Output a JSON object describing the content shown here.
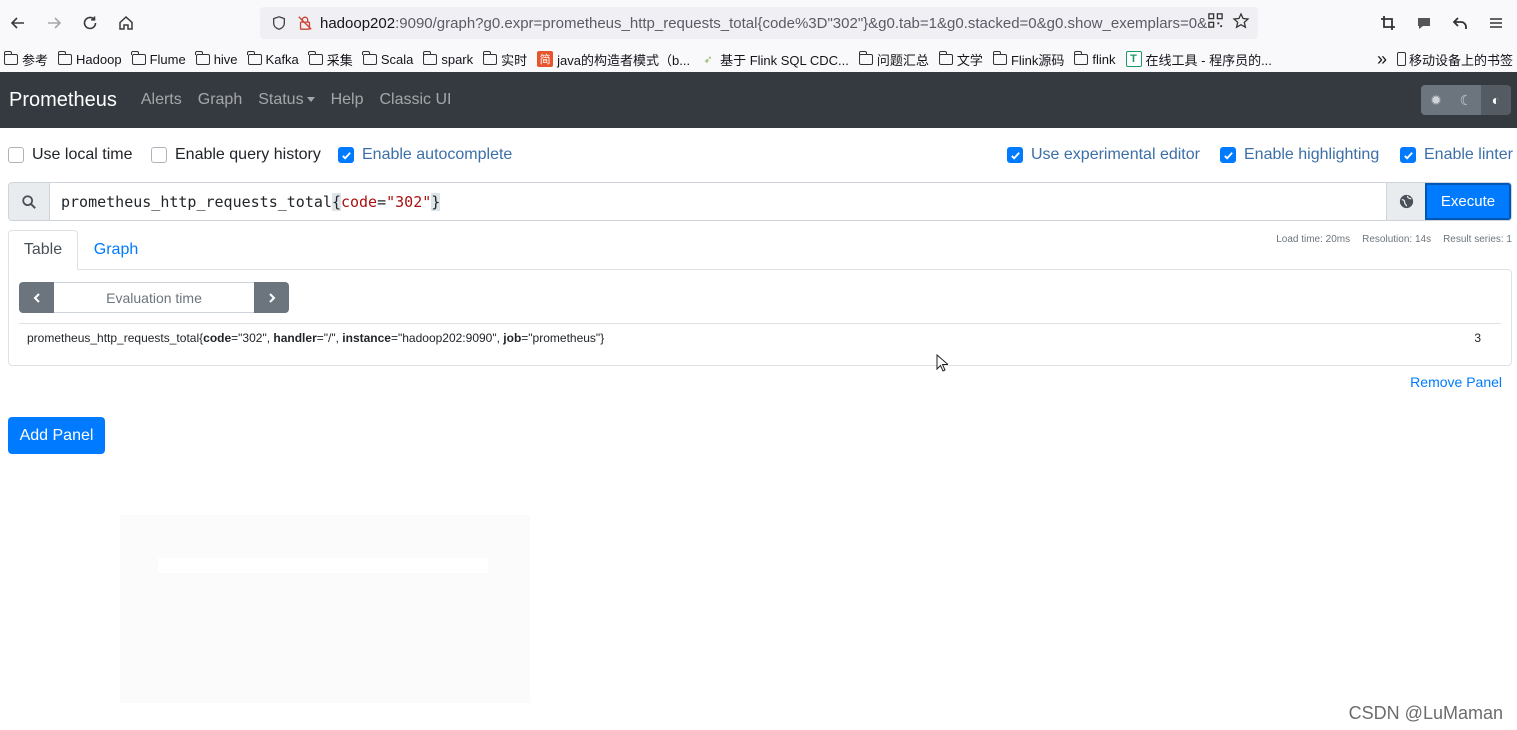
{
  "browser": {
    "url_host": "hadoop202",
    "url_rest": ":9090/graph?g0.expr=prometheus_http_requests_total{code%3D\"302\"}&g0.tab=1&g0.stacked=0&g0.show_exemplars=0&",
    "icons": [
      "back-arrow-icon",
      "forward-arrow-icon",
      "reload-icon",
      "home-icon",
      "shield-icon",
      "insecure-lock-icon",
      "qr-code-icon",
      "star-icon",
      "crop-icon",
      "chat-icon",
      "undo-icon",
      "menu-icon"
    ]
  },
  "bookmarks": {
    "items": [
      {
        "label": "参考",
        "type": "folder"
      },
      {
        "label": "Hadoop",
        "type": "folder"
      },
      {
        "label": "Flume",
        "type": "folder"
      },
      {
        "label": "hive",
        "type": "folder"
      },
      {
        "label": "Kafka",
        "type": "folder"
      },
      {
        "label": "采集",
        "type": "folder"
      },
      {
        "label": "Scala",
        "type": "folder"
      },
      {
        "label": "spark",
        "type": "folder"
      },
      {
        "label": "实时",
        "type": "folder"
      },
      {
        "label": "java的构造者模式（b...",
        "type": "site",
        "color": "#e8542d"
      },
      {
        "label": "基于 Flink SQL CDC...",
        "type": "site",
        "color": "#8ab85a"
      },
      {
        "label": "问题汇总",
        "type": "folder"
      },
      {
        "label": "文学",
        "type": "folder"
      },
      {
        "label": "Flink源码",
        "type": "folder"
      },
      {
        "label": "flink",
        "type": "folder"
      },
      {
        "label": "在线工具 - 程序员的...",
        "type": "site",
        "color": "#1a9c64"
      }
    ],
    "overflow": "»",
    "mobile": "移动设备上的书签"
  },
  "navbar": {
    "brand": "Prometheus",
    "links": [
      "Alerts",
      "Graph",
      "Status",
      "Help",
      "Classic UI"
    ]
  },
  "options": {
    "use_local_time": {
      "label": "Use local time",
      "checked": false
    },
    "enable_query_history": {
      "label": "Enable query history",
      "checked": false
    },
    "enable_autocomplete": {
      "label": "Enable autocomplete",
      "checked": true
    },
    "use_experimental_editor": {
      "label": "Use experimental editor",
      "checked": true
    },
    "enable_highlighting": {
      "label": "Enable highlighting",
      "checked": true
    },
    "enable_linter": {
      "label": "Enable linter",
      "checked": true
    }
  },
  "query": {
    "metric": "prometheus_http_requests_total",
    "label_name": "code",
    "label_value": "\"302\"",
    "execute_label": "Execute"
  },
  "panel": {
    "tabs": [
      "Table",
      "Graph"
    ],
    "stats": {
      "load_time": "Load time: 20ms",
      "resolution": "Resolution: 14s",
      "result_series": "Result series: 1"
    },
    "eval_placeholder": "Evaluation time",
    "result": {
      "metric": "prometheus_http_requests_total",
      "labels": [
        {
          "name": "code",
          "value": "\"302\""
        },
        {
          "name": "handler",
          "value": "\"/\""
        },
        {
          "name": "instance",
          "value": "\"hadoop202:9090\""
        },
        {
          "name": "job",
          "value": "\"prometheus\""
        }
      ],
      "value": "3"
    },
    "remove_label": "Remove Panel"
  },
  "add_panel_label": "Add Panel",
  "watermark": "CSDN @LuMaman"
}
